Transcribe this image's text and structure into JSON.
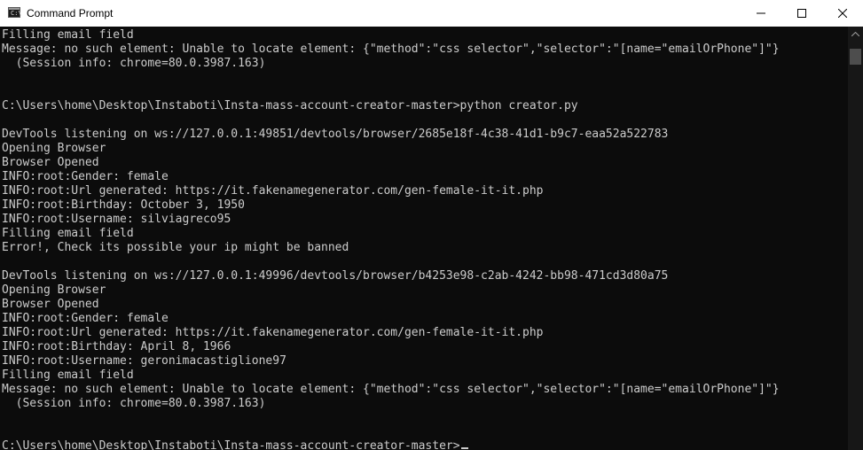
{
  "window": {
    "title": "Command Prompt",
    "icon": "cmd-icon"
  },
  "controls": {
    "minimize_icon": "minimize-icon",
    "maximize_icon": "maximize-icon",
    "close_icon": "close-icon"
  },
  "colors": {
    "console_background": "#0c0c0c",
    "console_text": "#cccccc",
    "titlebar_background": "#ffffff"
  },
  "console": {
    "lines": [
      "Filling email field",
      "Message: no such element: Unable to locate element: {\"method\":\"css selector\",\"selector\":\"[name=\"emailOrPhone\"]\"}",
      "  (Session info: chrome=80.0.3987.163)",
      "",
      "",
      "C:\\Users\\home\\Desktop\\Instaboti\\Insta-mass-account-creator-master>python creator.py",
      "",
      "DevTools listening on ws://127.0.0.1:49851/devtools/browser/2685e18f-4c38-41d1-b9c7-eaa52a522783",
      "Opening Browser",
      "Browser Opened",
      "INFO:root:Gender: female",
      "INFO:root:Url generated: https://it.fakenamegenerator.com/gen-female-it-it.php",
      "INFO:root:Birthday: October 3, 1950",
      "INFO:root:Username: silviagreco95",
      "Filling email field",
      "Error!, Check its possible your ip might be banned",
      "",
      "DevTools listening on ws://127.0.0.1:49996/devtools/browser/b4253e98-c2ab-4242-bb98-471cd3d80a75",
      "Opening Browser",
      "Browser Opened",
      "INFO:root:Gender: female",
      "INFO:root:Url generated: https://it.fakenamegenerator.com/gen-female-it-it.php",
      "INFO:root:Birthday: April 8, 1966",
      "INFO:root:Username: geronimacastiglione97",
      "Filling email field",
      "Message: no such element: Unable to locate element: {\"method\":\"css selector\",\"selector\":\"[name=\"emailOrPhone\"]\"}",
      "  (Session info: chrome=80.0.3987.163)",
      "",
      ""
    ],
    "prompt": "C:\\Users\\home\\Desktop\\Instaboti\\Insta-mass-account-creator-master>"
  }
}
